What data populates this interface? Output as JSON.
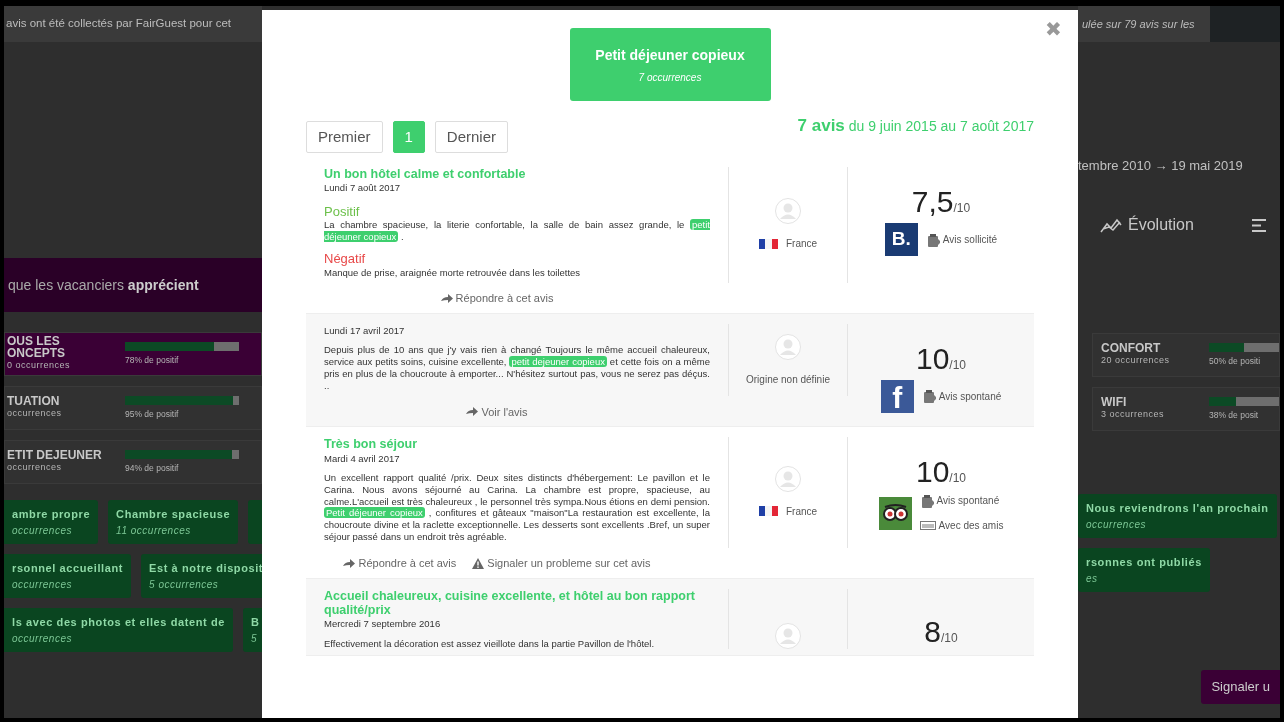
{
  "background": {
    "left": {
      "header_text": "avis ont été collectés par FairGuest pour cet",
      "banner": "que les vacanciers **apprécient**",
      "concepts": [
        {
          "name_lines": [
            "OUS LES",
            "ONCEPTS"
          ],
          "occurrences": "0 occurrences",
          "level": 0.78,
          "percent": "78% de positif",
          "selected": true
        },
        {
          "name_lines": [
            "TUATION"
          ],
          "occurrences": "occurrences",
          "level": 0.95,
          "percent": "95% de positif",
          "selected": false
        },
        {
          "name_lines": [
            "ETIT DEJEUNER"
          ],
          "occurrences": "occurrences",
          "level": 0.94,
          "percent": "94% de positif",
          "selected": false
        }
      ],
      "tag_rows": [
        [
          {
            "label": "ambre propre",
            "occurrences": "occurrences"
          },
          {
            "label": "Chambre spacieuse",
            "occurrences": "11 occurrences"
          },
          {}
        ],
        [
          {
            "label": "rsonnel accueillant",
            "occurrences": "occurrences"
          },
          {
            "label": "Est à notre disposit",
            "occurrences": "5 occurrences"
          }
        ],
        [
          {
            "label": "ls avec des photos et elles datent de",
            "occurrences": "occurrences"
          },
          {
            "label": "B",
            "occurrences": "5"
          }
        ]
      ]
    },
    "right": {
      "header_text": "ulée sur 79 avis sur les",
      "date_range": "tembre 2010 → 19 mai 2019",
      "evolution": "Évolution",
      "concepts": [
        {
          "name_lines": [
            "CONFORT"
          ],
          "occurrences": "20 occurrences",
          "level": 0.5,
          "percent": "50% de positi",
          "selected": false
        },
        {
          "name_lines": [
            "WIFI"
          ],
          "occurrences": "3 occurrences",
          "level": 0.38,
          "percent": "38% de posit",
          "selected": false
        }
      ],
      "tag_rows": [
        [
          {
            "label": "Nous reviendrons l'an prochain",
            "occurrences": "occurrences"
          }
        ],
        [
          {
            "label": "rsonnes ont publiés",
            "occurrences": "es"
          }
        ]
      ],
      "report_button": "Signaler u"
    }
  },
  "modal": {
    "close": "✖",
    "header": {
      "title": "Petit déjeuner copieux",
      "subtitle": "7 occurrences"
    },
    "pagination": [
      {
        "label": "Premier",
        "selected": false
      },
      {
        "label": "1",
        "selected": true
      },
      {
        "label": "Dernier",
        "selected": false
      }
    ],
    "summary": {
      "count": "7 avis",
      "range": "du 9 juin 2015 au 7 août 2017"
    },
    "reviews": [
      {
        "title": "Un bon hôtel calme et confortable",
        "date": "Lundi 7 août 2017",
        "sections": [
          {
            "kind": "positive",
            "label": "Positif",
            "parts": [
              {
                "text": "La chambre spacieuse, la literie confortable, la salle de bain assez grande, le ",
                "highlighted": false
              },
              {
                "text": "petit déjeuner copieux",
                "highlighted": true
              },
              {
                "text": " .",
                "highlighted": false
              }
            ]
          },
          {
            "kind": "negative",
            "label": "Négatif",
            "parts": [
              {
                "text": "Manque de prise, araignée morte retrouvée dans les toilettes",
                "highlighted": false
              }
            ]
          }
        ],
        "origin": {
          "kind": "country",
          "text": "France"
        },
        "score": "7,5",
        "scale": "/10",
        "source": {
          "kind": "booking",
          "logo_text": "B."
        },
        "tags": [
          {
            "kind": "solicited",
            "text": "Avis sollicité"
          }
        ],
        "actions": [
          {
            "kind": "reply",
            "text": "Répondre à cet avis"
          }
        ]
      },
      {
        "date": "Lundi 17 avril 2017",
        "sections": [
          {
            "kind": "plain",
            "parts": [
              {
                "text": "Depuis plus de 10 ans que j'y vais rien à changé Toujours le même accueil chaleureux, service aux petits soins, cuisine excellente, ",
                "highlighted": false
              },
              {
                "text": "petit dejeuner copieux",
                "highlighted": true
              },
              {
                "text": "  et cette fois on a même pris en plus de la choucroute à emporter... N'hésitez surtout pas, vous ne serez pas déçus. ..",
                "highlighted": false
              }
            ]
          }
        ],
        "origin": {
          "kind": "unknown",
          "text": "Origine non définie"
        },
        "score": "10",
        "scale": "/10",
        "source": {
          "kind": "facebook",
          "logo_text": "f"
        },
        "tags": [
          {
            "kind": "spontaneous",
            "text": "Avis spontané"
          }
        ],
        "actions": [
          {
            "kind": "view",
            "text": "Voir l'avis"
          }
        ]
      },
      {
        "title": "Très bon séjour",
        "date": "Mardi 4 avril 2017",
        "sections": [
          {
            "kind": "plain",
            "parts": [
              {
                "text": "Un excellent rapport qualité /prix. Deux sites distincts d'hébergement: Le pavillon et le Carina. Nous avons séjourné au Carina. La chambre est propre, spacieuse, au calme.L'accueil est très chaleureux , le personnel très sympa.Nous étions en demi pension. ",
                "highlighted": false
              },
              {
                "text": "Petit déjeuner copieux",
                "highlighted": true
              },
              {
                "text": " , confitures et gâteaux \"maison\"La restauration est excellente, la choucroute divine et la raclette exceptionnelle. Les desserts sont excellents .Bref, un super séjour passé dans un endroit très agréable.",
                "highlighted": false
              }
            ]
          }
        ],
        "origin": {
          "kind": "country",
          "text": "France"
        },
        "score": "10",
        "scale": "/10",
        "source": {
          "kind": "tripadvisor"
        },
        "tags": [
          {
            "kind": "spontaneous",
            "text": "Avis spontané"
          },
          {
            "kind": "group",
            "text": "Avec des amis"
          }
        ],
        "actions": [
          {
            "kind": "reply",
            "text": "Répondre à cet avis"
          },
          {
            "kind": "report",
            "text": "Signaler un probleme sur cet avis"
          }
        ]
      },
      {
        "title": "Accueil chaleureux, cuisine excellente, et hôtel au bon rapport qualité/prix",
        "date": "Mercredi 7 septembre 2016",
        "sections": [
          {
            "kind": "plain",
            "parts": [
              {
                "text": "Effectivement la décoration est assez vieillote dans la partie Pavillon de l'hôtel.",
                "highlighted": false
              }
            ]
          }
        ],
        "origin": {
          "kind": "hidden"
        },
        "score": "8",
        "scale": "/10"
      }
    ]
  }
}
